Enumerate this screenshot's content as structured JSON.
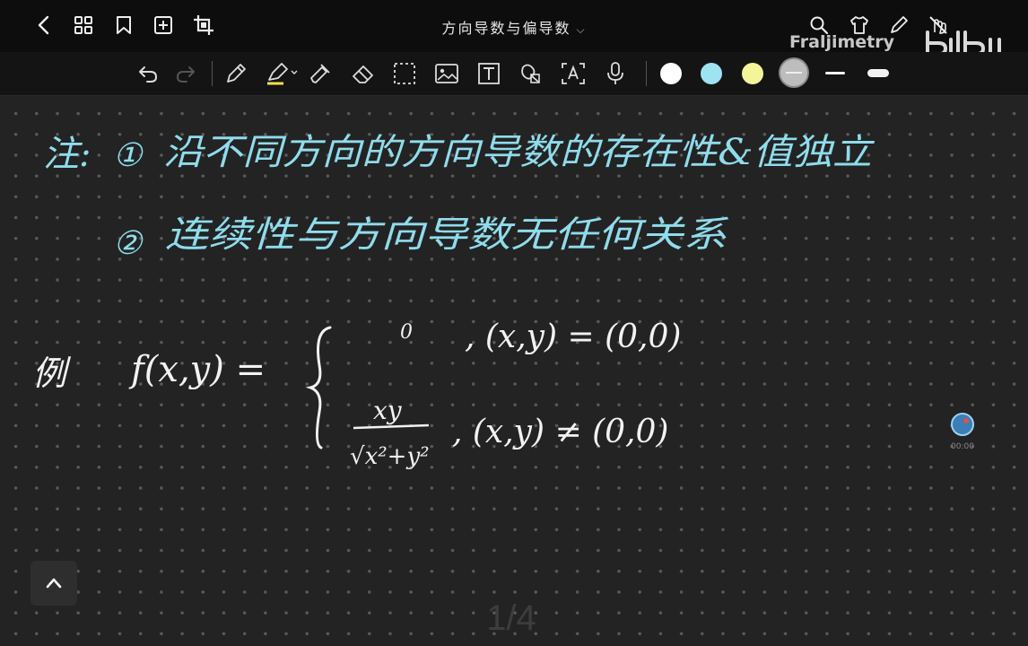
{
  "document": {
    "title": "方向导数与偏导数"
  },
  "watermark": {
    "channel": "Fraljimetry",
    "logo": "bilibili"
  },
  "colors": {
    "white": "#ffffff",
    "blue": "#9ee3f2",
    "yellow": "#f4f49a",
    "gray": "#bdbdbd",
    "ink_blue": "#8fdcec",
    "ink_white": "#f2f2f2"
  },
  "notes": {
    "line1": {
      "label": "注:",
      "num": "①",
      "text": "沿不同方向的方向导数的存在性&值独立"
    },
    "line2": {
      "num": "②",
      "text": "连续性与方向导数无任何关系"
    },
    "example": {
      "label": "例",
      "func": "f(x,y) =",
      "case1_value": "0",
      "case1_cond": ", (x,y) = (0,0)",
      "case2_num": "xy",
      "case2_den": "√x²+y²",
      "case2_cond": ", (x,y) ≠ (0,0)"
    }
  },
  "recording": {
    "time": "00:00"
  },
  "pager": {
    "indicator": "1/4"
  }
}
